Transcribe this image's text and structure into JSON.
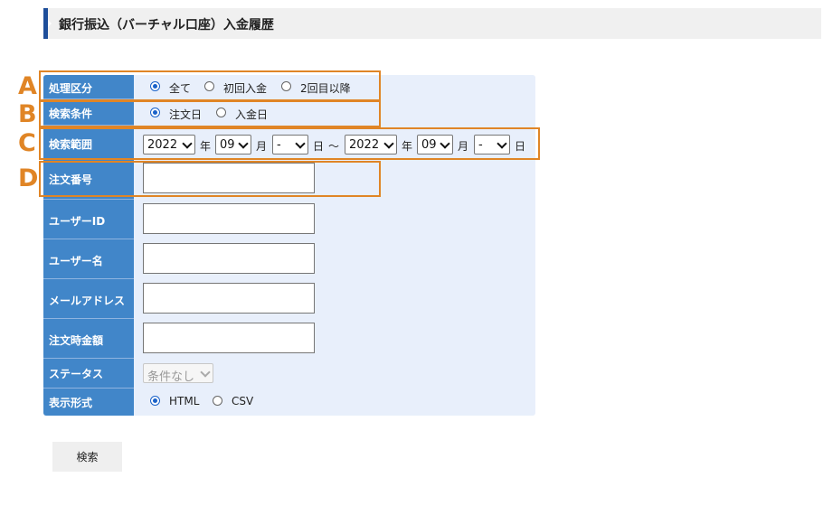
{
  "page_title": "銀行振込（バーチャル口座）入金履歴",
  "form": {
    "processing": {
      "label": "処理区分",
      "options": [
        "全て",
        "初回入金",
        "2回目以降"
      ],
      "selected": 0
    },
    "condition": {
      "label": "検索条件",
      "options": [
        "注文日",
        "入金日"
      ],
      "selected": 0
    },
    "range": {
      "label": "検索範囲",
      "from_year": "2022",
      "from_month": "09",
      "from_day": "-",
      "to_year": "2022",
      "to_month": "09",
      "to_day": "-",
      "unit_year": "年",
      "unit_month": "月",
      "unit_day": "日",
      "tilde": "～"
    },
    "order_number": {
      "label": "注文番号",
      "value": ""
    },
    "user_id": {
      "label": "ユーザーID",
      "value": ""
    },
    "user_name": {
      "label": "ユーザー名",
      "value": ""
    },
    "email": {
      "label": "メールアドレス",
      "value": ""
    },
    "order_amount": {
      "label": "注文時金額",
      "value": ""
    },
    "status": {
      "label": "ステータス",
      "value": "条件なし"
    },
    "display_format": {
      "label": "表示形式",
      "options": [
        "HTML",
        "CSV"
      ],
      "selected": 0
    }
  },
  "search_button": "検索",
  "callouts": [
    "A",
    "B",
    "C",
    "D"
  ],
  "colors": {
    "label_bg": "#4186c9",
    "panel_bg": "#e8effb",
    "callout": "#e08526",
    "title_accent": "#1e4e9a"
  }
}
